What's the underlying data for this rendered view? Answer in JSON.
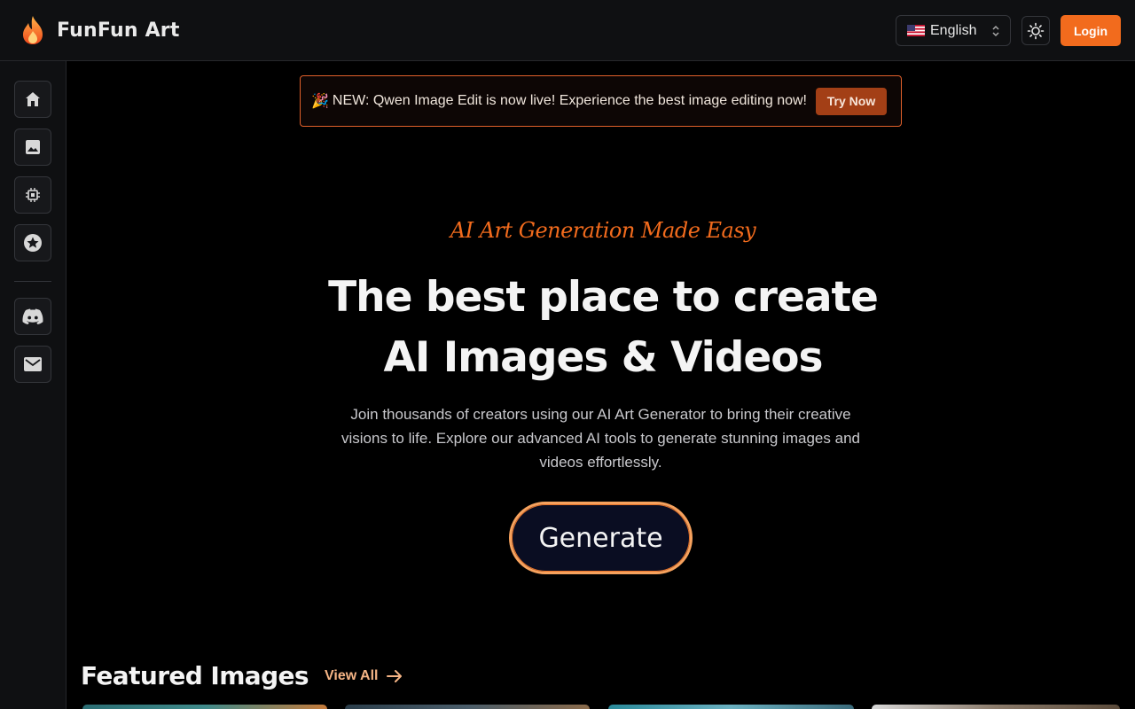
{
  "header": {
    "brand_name": "FunFun Art",
    "language": "English",
    "login_label": "Login"
  },
  "sidebar": {
    "items": [
      {
        "icon": "home-icon"
      },
      {
        "icon": "image-icon"
      },
      {
        "icon": "chip-icon"
      },
      {
        "icon": "star-icon"
      },
      {
        "icon": "discord-icon"
      },
      {
        "icon": "mail-icon"
      }
    ]
  },
  "announcement": {
    "emoji": "🎉",
    "text": "NEW: Qwen Image Edit is now live! Experience the best image editing now!",
    "cta_label": "Try Now"
  },
  "hero": {
    "tagline": "AI Art Generation Made Easy",
    "title_line1": "The best place to create",
    "title_line2": "AI Images & Videos",
    "subtitle": "Join thousands of creators using our AI Art Generator to bring their creative visions to life. Explore our advanced AI tools to generate stunning images and videos effortlessly.",
    "generate_label": "Generate"
  },
  "featured": {
    "title": "Featured Images",
    "view_all_label": "View All"
  },
  "colors": {
    "accent": "#f26b1d",
    "background": "#000000",
    "panel": "#0f1012"
  }
}
